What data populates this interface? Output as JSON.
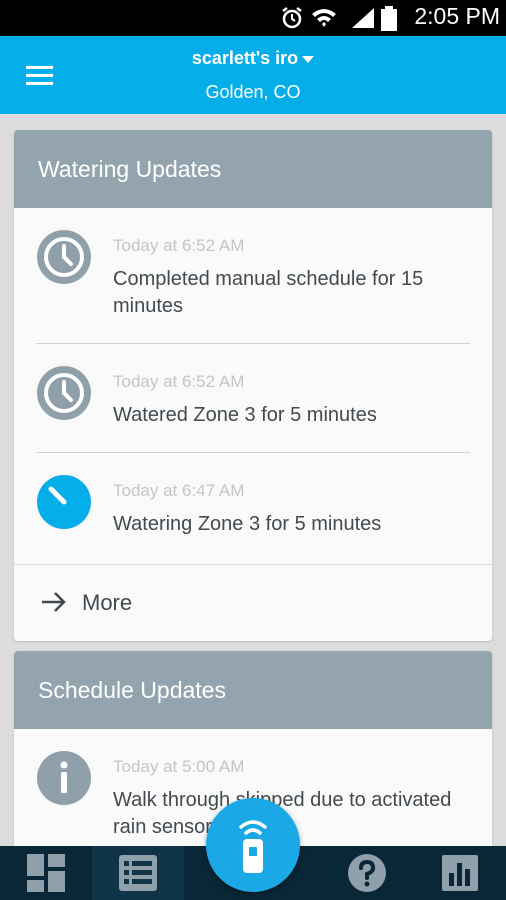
{
  "status_bar": {
    "time": "2:05 PM",
    "icons": [
      "alarm-icon",
      "wifi-icon",
      "signal-icon",
      "battery-icon"
    ]
  },
  "header": {
    "device_name": "scarlett's iro",
    "location": "Golden, CO",
    "color": "#06aee9"
  },
  "watering_updates": {
    "title": "Watering Updates",
    "entries": [
      {
        "time": "Today at 6:52 AM",
        "text": "Completed manual schedule for 15 minutes",
        "icon": "clock-icon"
      },
      {
        "time": "Today at 6:52 AM",
        "text": "Watered Zone 3 for 5 minutes",
        "icon": "clock-icon"
      },
      {
        "time": "Today at 6:47 AM",
        "text": "Watering Zone 3 for 5 minutes",
        "icon": "watering-progress-icon"
      }
    ],
    "more_label": "More"
  },
  "schedule_updates": {
    "title": "Schedule Updates",
    "entries": [
      {
        "time": "Today at 5:00 AM",
        "text": "Walk through skipped due to activated rain sensor",
        "icon": "info-icon"
      }
    ]
  },
  "bottom_nav": {
    "items": [
      "dashboard-icon",
      "list-icon",
      "remote-icon",
      "help-icon",
      "chart-icon"
    ],
    "active": "list-icon"
  },
  "colors": {
    "accent": "#06aee9",
    "card_header": "#93a4ae",
    "nav_bg": "#0a2738",
    "icon_gray": "#8fa0aa"
  }
}
